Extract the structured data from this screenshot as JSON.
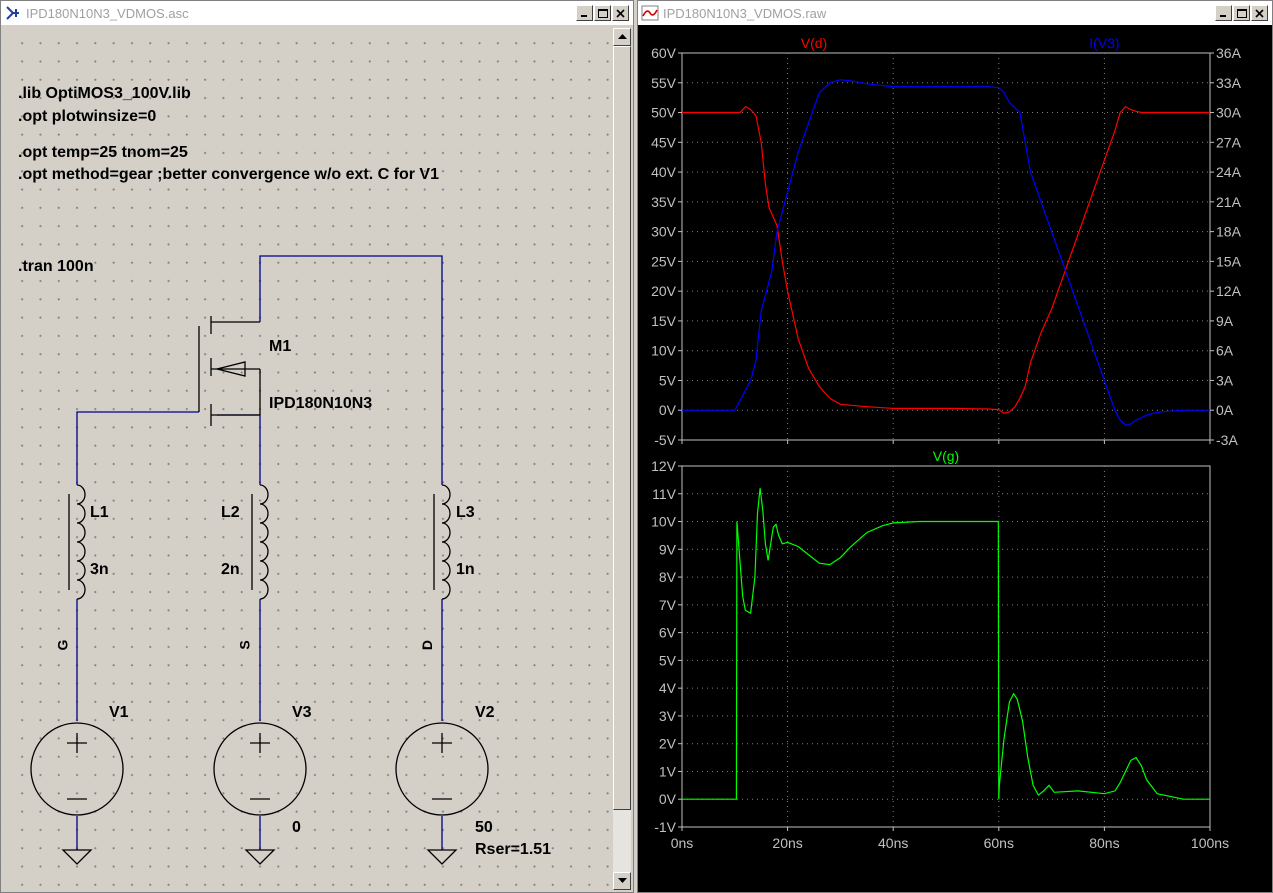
{
  "schematic_window": {
    "title": "IPD180N10N3_VDMOS.asc",
    "directives": [
      ".lib OptiMOS3_100V.lib",
      ".opt plotwinsize=0",
      ".opt temp=25 tnom=25",
      ".opt method=gear ;better convergence w/o ext. C for V1",
      ".tran 100n"
    ],
    "mosfet": {
      "name": "M1",
      "model": "IPD180N10N3"
    },
    "inductors": [
      {
        "name": "L1",
        "value": "3n"
      },
      {
        "name": "L2",
        "value": "2n"
      },
      {
        "name": "L3",
        "value": "1n"
      }
    ],
    "net_labels": [
      "G",
      "S",
      "D"
    ],
    "sources": [
      {
        "name": "V1",
        "value": ""
      },
      {
        "name": "V3",
        "value": "0"
      },
      {
        "name": "V2",
        "value": "50",
        "extra": "Rser=1.51"
      }
    ]
  },
  "plot_window": {
    "title": "IPD180N10N3_VDMOS.raw",
    "colors": {
      "vd": "#ff0000",
      "iv3": "#0000ff",
      "vg": "#00ff00",
      "axis": "#c0c0c0",
      "grid": "#808080"
    }
  },
  "chart_data": [
    {
      "type": "line",
      "pane": "top",
      "xlabel": "",
      "x_unit": "ns",
      "xlim": [
        0,
        100
      ],
      "x_ticks": [
        "0ns",
        "20ns",
        "40ns",
        "60ns",
        "80ns",
        "100ns"
      ],
      "left_axis": {
        "ylim": [
          -5,
          60
        ],
        "ticks": [
          "-5V",
          "0V",
          "5V",
          "10V",
          "15V",
          "20V",
          "25V",
          "30V",
          "35V",
          "40V",
          "45V",
          "50V",
          "55V",
          "60V"
        ]
      },
      "right_axis": {
        "ylim": [
          -3,
          36
        ],
        "ticks": [
          "-3A",
          "0A",
          "3A",
          "6A",
          "9A",
          "12A",
          "15A",
          "18A",
          "21A",
          "24A",
          "27A",
          "30A",
          "33A",
          "36A"
        ]
      },
      "series": [
        {
          "name": "V(d)",
          "axis": "left",
          "color": "#ff0000",
          "x": [
            0,
            10,
            11,
            12,
            13,
            14,
            15,
            15.8,
            16.5,
            17,
            18,
            19,
            20,
            22,
            24,
            26,
            28,
            30,
            35,
            40,
            50,
            58,
            60,
            61,
            62,
            63,
            64,
            65,
            66,
            68,
            70,
            72,
            74,
            76,
            78,
            80,
            82,
            83,
            84,
            85,
            86,
            87,
            88,
            100
          ],
          "y": [
            50,
            50,
            50,
            51,
            50.5,
            49.5,
            45,
            38,
            34,
            33,
            31,
            25,
            20,
            12,
            7,
            4,
            2,
            1,
            0.6,
            0.3,
            0.3,
            0.2,
            0.1,
            -0.5,
            -0.3,
            0.5,
            2,
            4,
            8,
            13,
            17,
            22,
            27,
            32,
            37,
            42,
            47,
            50,
            51,
            50.5,
            50.2,
            50,
            50,
            50
          ]
        },
        {
          "name": "I(V3)",
          "axis": "right",
          "color": "#0000ff",
          "x": [
            0,
            10,
            11,
            12,
            13,
            14,
            15,
            16,
            17,
            18,
            20,
            22,
            24,
            26,
            28,
            30,
            32,
            35,
            40,
            50,
            58,
            60,
            61,
            62,
            63,
            64,
            65,
            66,
            68,
            70,
            72,
            74,
            76,
            78,
            80,
            82,
            83,
            84,
            85,
            86,
            88,
            90,
            95,
            100
          ],
          "y": [
            0,
            0,
            1,
            2,
            3,
            5,
            10,
            12,
            14,
            18,
            22,
            26,
            29,
            32,
            33,
            33.3,
            33.2,
            32.9,
            32.6,
            32.6,
            32.6,
            32.5,
            32,
            31,
            30.5,
            30,
            27,
            24,
            21,
            18,
            15,
            12,
            9,
            6,
            3,
            0,
            -1,
            -1.5,
            -1.4,
            -1,
            -0.5,
            -0.2,
            0,
            0
          ]
        }
      ]
    },
    {
      "type": "line",
      "pane": "bottom",
      "xlabel": "",
      "x_unit": "ns",
      "xlim": [
        0,
        100
      ],
      "x_ticks": [
        "0ns",
        "20ns",
        "40ns",
        "60ns",
        "80ns",
        "100ns"
      ],
      "left_axis": {
        "ylim": [
          -1,
          12
        ],
        "ticks": [
          "-1V",
          "0V",
          "1V",
          "2V",
          "3V",
          "4V",
          "5V",
          "6V",
          "7V",
          "8V",
          "9V",
          "10V",
          "11V",
          "12V"
        ]
      },
      "series": [
        {
          "name": "V(g)",
          "axis": "left",
          "color": "#00ff00",
          "x": [
            0,
            10.3,
            10.4,
            10.6,
            11,
            11.5,
            12,
            13,
            13.8,
            14.3,
            14.8,
            15.3,
            15.8,
            16.3,
            16.8,
            17.3,
            17.8,
            18.3,
            19,
            20,
            22,
            24,
            26,
            28,
            30,
            32,
            35,
            38,
            40,
            45,
            50,
            55,
            59.9,
            60,
            60.1,
            61,
            62,
            62.8,
            63.5,
            64.5,
            65.5,
            66.5,
            67.5,
            68.5,
            69.5,
            70.5,
            75,
            80,
            82,
            83,
            84,
            85,
            86,
            87,
            88,
            90,
            95,
            100
          ],
          "y": [
            0,
            0,
            10,
            9.5,
            8.5,
            7.3,
            6.8,
            6.7,
            8,
            10.3,
            11.2,
            10.4,
            9.2,
            8.6,
            9.2,
            9.8,
            9.9,
            9.5,
            9.2,
            9.25,
            9.1,
            8.8,
            8.5,
            8.45,
            8.7,
            9.1,
            9.6,
            9.85,
            9.95,
            10,
            10,
            10,
            10,
            0,
            0.5,
            2.2,
            3.5,
            3.8,
            3.6,
            2.8,
            1.5,
            0.5,
            0.15,
            0.3,
            0.5,
            0.25,
            0.3,
            0.2,
            0.3,
            0.6,
            1,
            1.4,
            1.5,
            1.2,
            0.7,
            0.2,
            0,
            0
          ]
        }
      ]
    }
  ]
}
